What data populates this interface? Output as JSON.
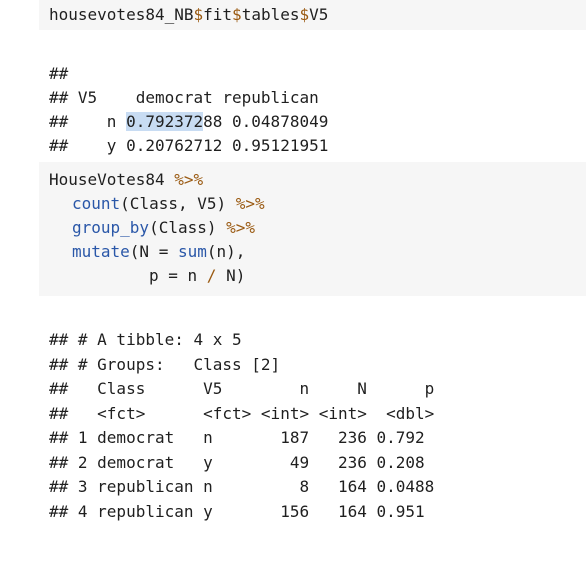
{
  "chunk1": {
    "code": {
      "obj": "housevotes84_NB",
      "op1": "$",
      "f1": "fit",
      "op2": "$",
      "f2": "tables",
      "op3": "$",
      "f3": "V5"
    },
    "output": {
      "l1": "##",
      "l2": "## V5    democrat republican",
      "l3_pre": "##    n ",
      "l3_sel": "0.792372",
      "l3_post": "88 0.04878049",
      "l4": "##    y 0.20762712 0.95121951"
    }
  },
  "chunk2": {
    "code": {
      "line1_obj": "HouseVotes84 ",
      "pipe": "%>%",
      "line2_fn": "count",
      "line2_args": "(Class, V5) ",
      "line3_fn": "group_by",
      "line3_args": "(Class) ",
      "line4_fn": "mutate",
      "line4_args1": "(N = ",
      "line4_fn2": "sum",
      "line4_args2": "(n),",
      "line5_pre": "p = n ",
      "line5_op": "/",
      "line5_post": " N)"
    },
    "output": [
      "## # A tibble: 4 x 5",
      "## # Groups:   Class [2]",
      "##   Class      V5        n     N      p",
      "##   <fct>      <fct> <int> <int>  <dbl>",
      "## 1 democrat   n       187   236 0.792",
      "## 2 democrat   y        49   236 0.208",
      "## 3 republican n         8   164 0.0488",
      "## 4 republican y       156   164 0.951"
    ]
  }
}
